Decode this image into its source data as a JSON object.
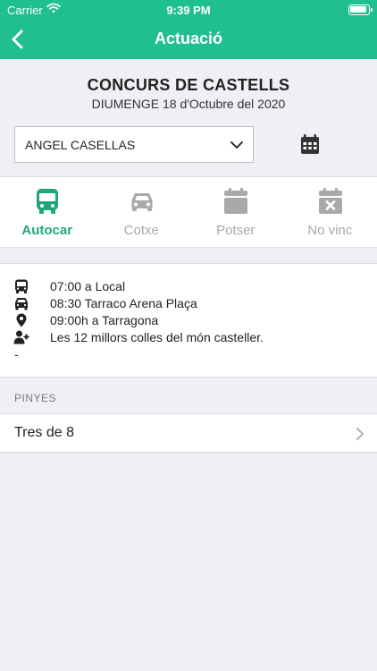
{
  "status_bar": {
    "carrier": "Carrier",
    "time": "9:39 PM"
  },
  "nav": {
    "title": "Actuació",
    "back_icon": "chevron-left-icon"
  },
  "event": {
    "title": "CONCURS DE CASTELLS",
    "date": "DIUMENGE 18 d'Octubre del 2020"
  },
  "member_select": {
    "value": "ANGEL CASELLAS"
  },
  "colors": {
    "brand": "#1fbf8f",
    "active": "#1fa77c",
    "inactive": "#a9a9a9",
    "background": "#efeff4"
  },
  "transport_options": [
    {
      "label": "Autocar",
      "icon": "bus-icon",
      "active": true
    },
    {
      "label": "Cotxe",
      "icon": "car-icon",
      "active": false
    },
    {
      "label": "Potser",
      "icon": "calendar-icon",
      "active": false
    },
    {
      "label": "No vinc",
      "icon": "calendar-times-icon",
      "active": false
    }
  ],
  "info": [
    {
      "icon": "bus-icon",
      "text": "07:00 a Local"
    },
    {
      "icon": "car-icon",
      "text": "08:30 Tarraco Arena Plaça"
    },
    {
      "icon": "map-marker-icon",
      "text": "09:00h a Tarragona"
    },
    {
      "icon": "user-plus-icon",
      "text": "Les 12 millors colles del món casteller."
    }
  ],
  "info_extra": "-",
  "pinyes": {
    "section_label": "PINYES",
    "items": [
      {
        "label": "Tres de 8"
      }
    ]
  }
}
